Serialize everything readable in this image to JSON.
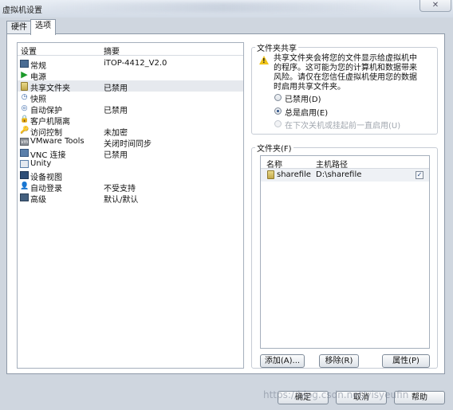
{
  "window": {
    "title": "虚拟机设置",
    "close_label": "✕"
  },
  "tabs": [
    {
      "label": "硬件"
    },
    {
      "label": "选项"
    }
  ],
  "settings_list": {
    "header_setting": "设置",
    "header_summary": "摘要",
    "items": [
      {
        "icon": "general-icon",
        "name": "常规",
        "summary": "iTOP-4412_V2.0"
      },
      {
        "icon": "power-icon",
        "name": "电源",
        "summary": ""
      },
      {
        "icon": "shared-folders-icon",
        "name": "共享文件夹",
        "summary": "已禁用"
      },
      {
        "icon": "snapshot-icon",
        "name": "快照",
        "summary": ""
      },
      {
        "icon": "autoprotect-icon",
        "name": "自动保护",
        "summary": "已禁用"
      },
      {
        "icon": "guest-isolation-icon",
        "name": "客户机隔离",
        "summary": ""
      },
      {
        "icon": "access-control-icon",
        "name": "访问控制",
        "summary": "未加密"
      },
      {
        "icon": "vmware-tools-icon",
        "name": "VMware Tools",
        "summary": "关闭时间同步"
      },
      {
        "icon": "vnc-icon",
        "name": "VNC 连接",
        "summary": "已禁用"
      },
      {
        "icon": "unity-icon",
        "name": "Unity",
        "summary": ""
      },
      {
        "icon": "appliance-view-icon",
        "name": "设备视图",
        "summary": ""
      },
      {
        "icon": "autologin-icon",
        "name": "自动登录",
        "summary": "不受支持"
      },
      {
        "icon": "advanced-icon",
        "name": "高级",
        "summary": "默认/默认"
      }
    ]
  },
  "folder_sharing": {
    "group_label": "文件夹共享",
    "warning_lines": [
      "共享文件夹会将您的文件显示给虚拟机中",
      "的程序。这可能为您的计算机和数据带来",
      "风险。请仅在您信任虚拟机使用您的数据",
      "时启用共享文件夹。"
    ],
    "options": [
      {
        "label": "已禁用(D)",
        "selected": false,
        "disabled": false
      },
      {
        "label": "总是启用(E)",
        "selected": true,
        "disabled": false
      },
      {
        "label": "在下次关机或挂起前一直启用(U)",
        "selected": false,
        "disabled": true
      }
    ]
  },
  "folders": {
    "group_label": "文件夹(F)",
    "header_name": "名称",
    "header_path": "主机路径",
    "rows": [
      {
        "name": "sharefile",
        "path": "D:\\sharefile",
        "checked": true
      }
    ]
  },
  "folder_buttons": {
    "add": "添加(A)...",
    "remove": "移除(R)",
    "properties": "属性(P)"
  },
  "footer_buttons": {
    "ok": "确定",
    "cancel": "取消",
    "help": "帮助"
  },
  "watermark": "https://blog.csdn.net/yisyeufin"
}
